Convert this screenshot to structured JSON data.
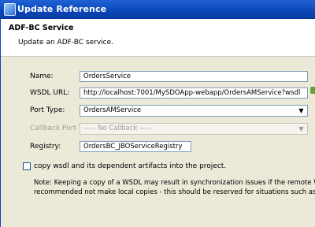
{
  "window": {
    "title": "Update Reference"
  },
  "header": {
    "title": "ADF-BC Service",
    "description": "Update an ADF-BC service."
  },
  "form": {
    "name": {
      "label": "Name:",
      "value": "OrdersService"
    },
    "wsdl_url": {
      "label": "WSDL URL:",
      "value": "http://localhost:7001/MySDOApp-webapp/OrdersAMService?wsdl"
    },
    "port_type": {
      "label": "Port Type:",
      "value": "OrdersAMService"
    },
    "callback_port_type": {
      "label": "Callback Port Type:",
      "value": "----- No Callback -----"
    },
    "registry": {
      "label": "Registry:",
      "value": "OrdersBC_JBOServiceRegistry"
    }
  },
  "copy_wsdl": {
    "label": "copy wsdl and its dependent artifacts into the project.",
    "checked": false
  },
  "note": {
    "line1": "Note: Keeping a copy of a WSDL may result in synchronization issues if the remote WSDL is update",
    "line2": "recommended not make local copies - this should be reserved for situations such as offline designin"
  },
  "icons": {
    "window": "update-reference-icon",
    "side": "wsdl-browse-icon"
  }
}
